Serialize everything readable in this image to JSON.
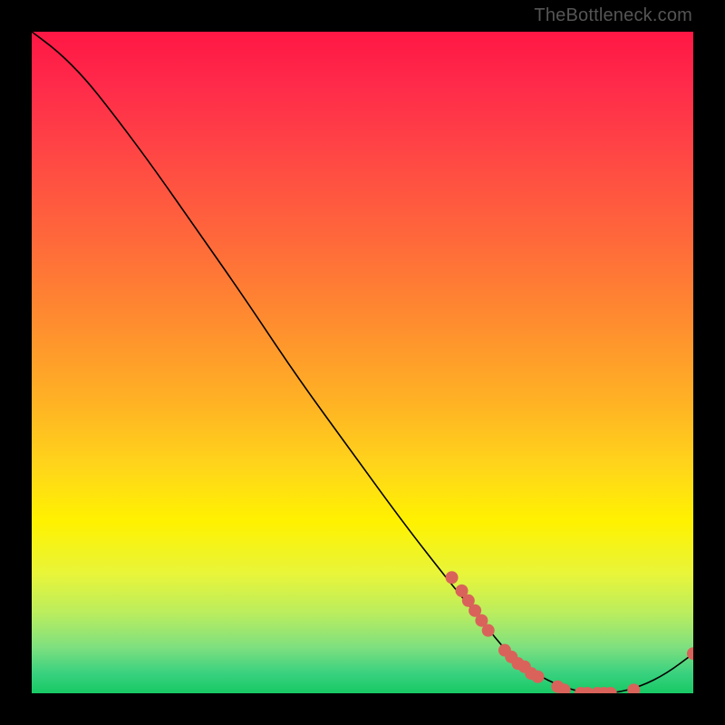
{
  "watermark": "TheBottleneck.com",
  "chart_data": {
    "type": "line",
    "title": "",
    "xlabel": "",
    "ylabel": "",
    "xlim": [
      0,
      100
    ],
    "ylim": [
      0,
      100
    ],
    "grid": false,
    "series": [
      {
        "name": "curve",
        "x": [
          0,
          4,
          8,
          12,
          18,
          25,
          32,
          40,
          48,
          56,
          63,
          68,
          72,
          76,
          80,
          84,
          88,
          92,
          96,
          100
        ],
        "y": [
          100,
          97,
          93,
          88,
          80,
          70,
          60,
          48,
          37,
          26,
          17,
          11,
          6,
          3,
          1,
          0,
          0,
          1,
          3,
          6
        ],
        "color": "#000000",
        "stroke_width": 1.6
      }
    ],
    "markers": [
      {
        "name": "dots",
        "color": "#d9635a",
        "radius": 7,
        "points": [
          {
            "x": 63.5,
            "y": 17.5
          },
          {
            "x": 65.0,
            "y": 15.5
          },
          {
            "x": 66.0,
            "y": 14.0
          },
          {
            "x": 67.0,
            "y": 12.5
          },
          {
            "x": 68.0,
            "y": 11.0
          },
          {
            "x": 69.0,
            "y": 9.5
          },
          {
            "x": 71.5,
            "y": 6.5
          },
          {
            "x": 72.5,
            "y": 5.5
          },
          {
            "x": 73.5,
            "y": 4.5
          },
          {
            "x": 74.5,
            "y": 4.0
          },
          {
            "x": 75.5,
            "y": 3.0
          },
          {
            "x": 76.5,
            "y": 2.5
          },
          {
            "x": 79.5,
            "y": 1.0
          },
          {
            "x": 80.5,
            "y": 0.5
          },
          {
            "x": 83.0,
            "y": 0.0
          },
          {
            "x": 84.0,
            "y": 0.0
          },
          {
            "x": 85.5,
            "y": 0.0
          },
          {
            "x": 86.5,
            "y": 0.0
          },
          {
            "x": 87.5,
            "y": 0.0
          },
          {
            "x": 91.0,
            "y": 0.5
          },
          {
            "x": 100.0,
            "y": 6.0
          }
        ]
      }
    ]
  }
}
